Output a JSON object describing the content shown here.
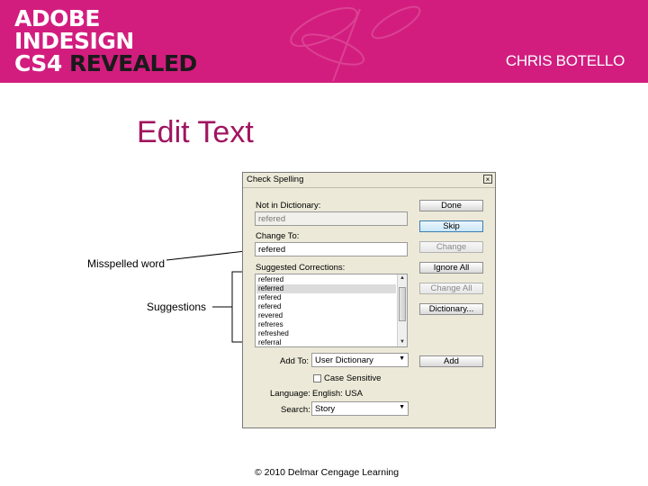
{
  "banner": {
    "line1": "ADOBE",
    "line2": "INDESIGN",
    "line3_prefix": "CS4",
    "line3_suffix": "REVEALED",
    "author": "CHRIS BOTELLO",
    "bg_color": "#d21d7f"
  },
  "slide_title": "Edit Text",
  "callouts": {
    "misspelled": "Misspelled word",
    "suggestions": "Suggestions"
  },
  "dialog": {
    "title": "Check Spelling",
    "close_glyph": "×",
    "not_in_dictionary_label": "Not in Dictionary:",
    "not_in_dictionary_value": "refered",
    "change_to_label": "Change To:",
    "change_to_value": "refered",
    "suggested_corrections_label": "Suggested Corrections:",
    "suggestions": [
      "referred",
      "referred",
      "refered",
      "refered",
      "revered",
      "refreres",
      "refreshed",
      "referral"
    ],
    "buttons": {
      "done": "Done",
      "skip": "Skip",
      "change": "Change",
      "ignore_all": "Ignore All",
      "change_all": "Change All",
      "dictionary": "Dictionary...",
      "add": "Add"
    },
    "add_to_label": "Add To:",
    "add_to_value": "User Dictionary",
    "case_sensitive_label": "Case Sensitive",
    "language_label": "Language:",
    "language_value": "English: USA",
    "search_label": "Search:",
    "search_value": "Story"
  },
  "copyright": "© 2010 Delmar Cengage Learning"
}
